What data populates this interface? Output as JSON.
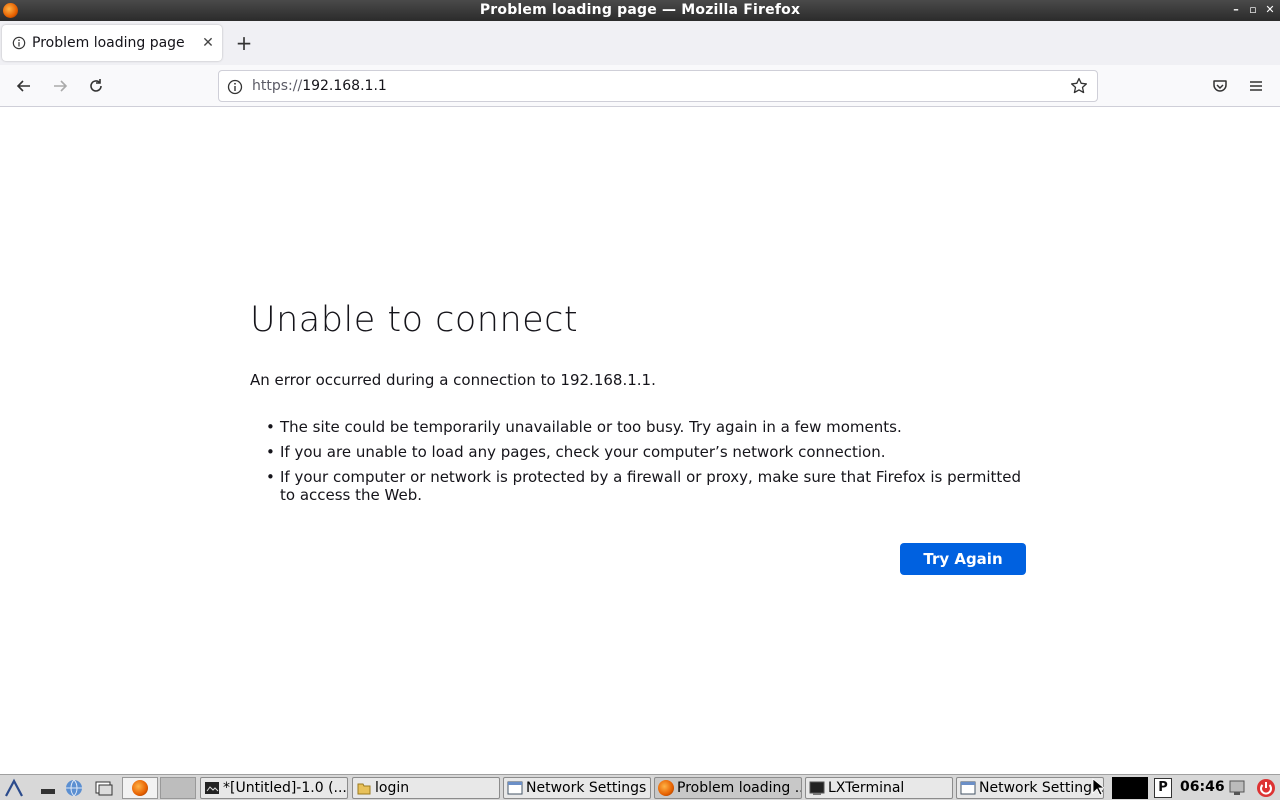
{
  "window": {
    "title": "Problem loading page — Mozilla Firefox"
  },
  "tabs": [
    {
      "label": "Problem loading page"
    }
  ],
  "navbar": {
    "url_scheme": "https://",
    "url_host": "192.168.1.1"
  },
  "error": {
    "title": "Unable to connect",
    "description": "An error occurred during a connection to 192.168.1.1.",
    "tips": [
      "The site could be temporarily unavailable or too busy. Try again in a few moments.",
      "If you are unable to load any pages, check your computer’s network connection.",
      "If your computer or network is protected by a firewall or proxy, make sure that Firefox is permitted to access the Web."
    ],
    "button_label": "Try Again",
    "button_color": "#0061e0"
  },
  "taskbar": {
    "windows": [
      {
        "label": "*[Untitled]-1.0 (...",
        "icon": "image-editor-icon"
      },
      {
        "label": "login",
        "icon": "folder-icon"
      },
      {
        "label": "Network Settings",
        "icon": "window-icon"
      },
      {
        "label": "Problem loading ...",
        "icon": "firefox-icon"
      },
      {
        "label": "LXTerminal",
        "icon": "terminal-icon"
      },
      {
        "label": "Network Setting...",
        "icon": "window-icon"
      }
    ],
    "clock": "06:46"
  }
}
